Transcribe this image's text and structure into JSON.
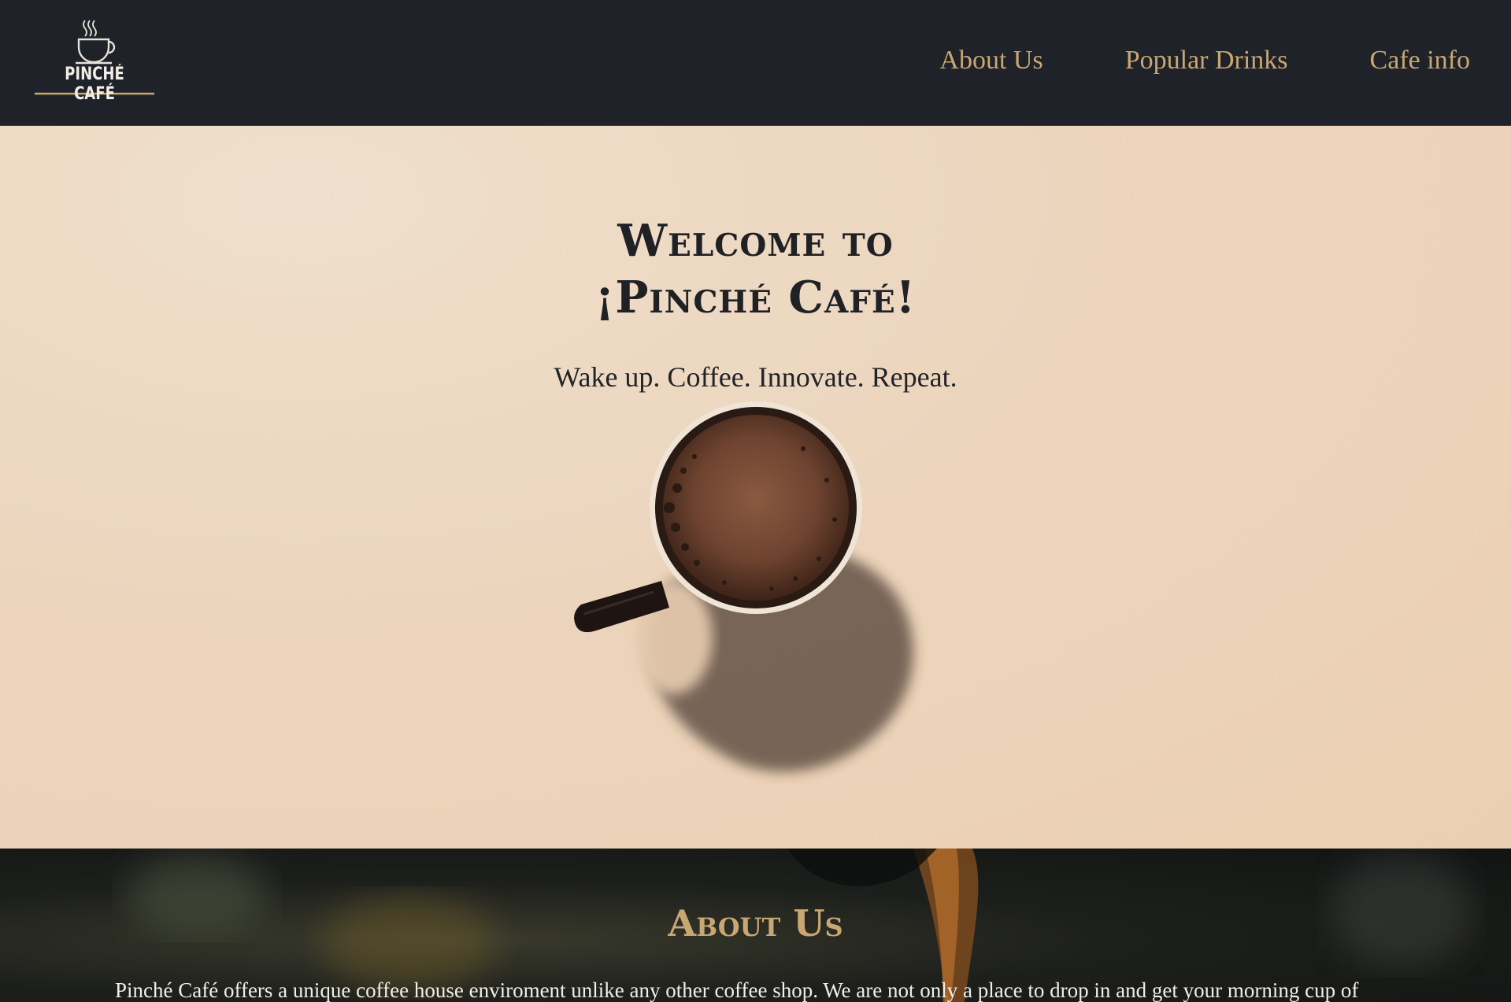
{
  "brand": {
    "logo_text": "PINCHÉ CAFÉ"
  },
  "nav": {
    "links": [
      {
        "label": "About Us"
      },
      {
        "label": "Popular Drinks"
      },
      {
        "label": "Cafe info"
      }
    ]
  },
  "hero": {
    "title_line1": "Welcome to",
    "title_line2": "¡Pinché Café!",
    "subtitle": "Wake up. Coffee. Innovate. Repeat."
  },
  "about": {
    "title": "About Us",
    "text": "Pinché Café offers a unique coffee house enviroment unlike any other coffee shop. We are not only a place to drop in and get your morning cup of"
  },
  "colors": {
    "nav_bg": "#1f2329",
    "accent_gold": "#c9a772",
    "hero_bg": "#ecd5bd",
    "dark_text": "#1f2125"
  },
  "icons": {
    "logo": "steaming-coffee-cup-icon",
    "hero_image": "coffee-cup-photo"
  }
}
